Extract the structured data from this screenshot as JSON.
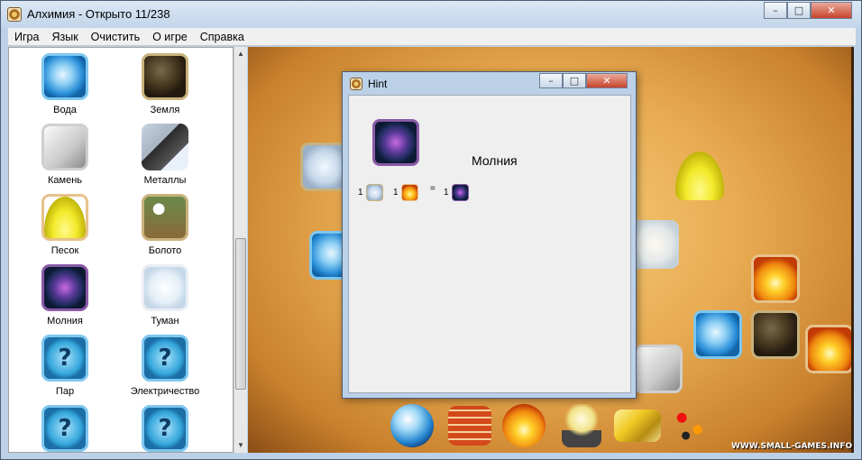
{
  "window": {
    "title": "Алхимия  - Открыто  11/238",
    "caption_buttons": [
      "minimize",
      "maximize",
      "close"
    ]
  },
  "menu": [
    "Игра",
    "Язык",
    "Очистить",
    "О игре",
    "Справка"
  ],
  "sidebar": {
    "elements": [
      {
        "label": "Вода",
        "icon": "water-drop-icon"
      },
      {
        "label": "Земля",
        "icon": "earth-icon"
      },
      {
        "label": "Камень",
        "icon": "stone-icon"
      },
      {
        "label": "Металлы",
        "icon": "metals-icon"
      },
      {
        "label": "Песок",
        "icon": "sand-icon"
      },
      {
        "label": "Болото",
        "icon": "swamp-icon"
      },
      {
        "label": "Молния",
        "icon": "lightning-icon"
      },
      {
        "label": "Туман",
        "icon": "fog-icon"
      },
      {
        "label": "Пар",
        "icon": "unknown-question-icon"
      },
      {
        "label": "Электричество",
        "icon": "unknown-question-icon"
      },
      {
        "label": "",
        "icon": "unknown-question-icon"
      },
      {
        "label": "",
        "icon": "unknown-question-icon"
      }
    ]
  },
  "hint": {
    "title": "Hint",
    "element_name": "Молния",
    "recipe": {
      "ingredients": [
        {
          "count": "1",
          "icon": "air-icon"
        },
        {
          "count": "1",
          "icon": "fire-icon"
        }
      ],
      "equals": "=",
      "result": {
        "count": "1",
        "icon": "lightning-icon"
      }
    }
  },
  "board": {
    "tokens": [
      "air-icon",
      "water-drop-icon",
      "sand-icon",
      "fog-icon",
      "fire-icon",
      "water-drop-icon",
      "earth-icon",
      "fire-icon",
      "stone-icon"
    ]
  },
  "toolbar": [
    "glass-sphere-icon",
    "bricks-icon",
    "water-fire-icon",
    "light-bulb-icon",
    "gold-bars-icon",
    "molecule-icon"
  ],
  "watermark": "WWW.SMALL-GAMES.INFO"
}
